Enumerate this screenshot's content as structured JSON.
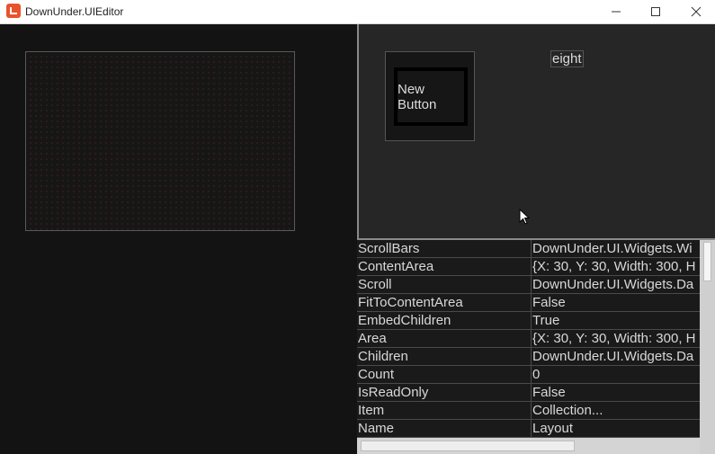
{
  "window": {
    "title": "DownUnder.UIEditor",
    "accent": "#e8532c"
  },
  "preview": {
    "button_label": "New Button",
    "label_text": "eight"
  },
  "properties": [
    {
      "name": "ScrollBars",
      "value": "DownUnder.UI.Widgets.Wi"
    },
    {
      "name": "ContentArea",
      "value": "{X: 30, Y: 30, Width: 300, H"
    },
    {
      "name": "Scroll",
      "value": "DownUnder.UI.Widgets.Da"
    },
    {
      "name": "FitToContentArea",
      "value": "False"
    },
    {
      "name": "EmbedChildren",
      "value": "True"
    },
    {
      "name": "Area",
      "value": "{X: 30, Y: 30, Width: 300, H"
    },
    {
      "name": "Children",
      "value": "DownUnder.UI.Widgets.Da"
    },
    {
      "name": "Count",
      "value": "0"
    },
    {
      "name": "IsReadOnly",
      "value": "False"
    },
    {
      "name": "Item",
      "value": "Collection..."
    },
    {
      "name": "Name",
      "value": "Layout"
    }
  ]
}
